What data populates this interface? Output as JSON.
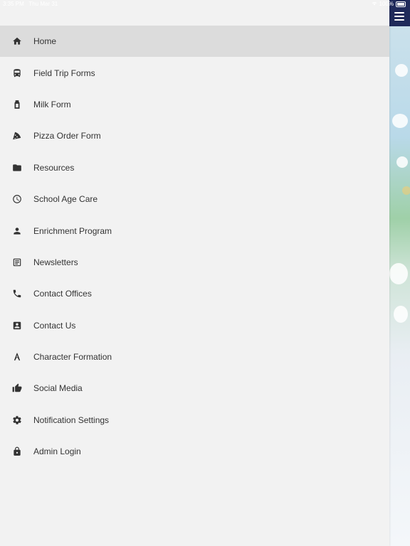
{
  "status_bar": {
    "time": "3:35 PM",
    "date": "Thu Mar 31",
    "battery": "100%"
  },
  "drawer": {
    "items": [
      {
        "label": "Home",
        "icon": "home-icon",
        "active": true
      },
      {
        "label": "Field Trip Forms",
        "icon": "bus-icon"
      },
      {
        "label": "Milk Form",
        "icon": "milk-carton-icon"
      },
      {
        "label": "Pizza Order Form",
        "icon": "pizza-icon"
      },
      {
        "label": "Resources",
        "icon": "folder-icon"
      },
      {
        "label": "School Age Care",
        "icon": "clock-icon"
      },
      {
        "label": "Enrichment Program",
        "icon": "person-icon"
      },
      {
        "label": "Newsletters",
        "icon": "document-icon"
      },
      {
        "label": "Contact Offices",
        "icon": "phone-icon"
      },
      {
        "label": "Contact Us",
        "icon": "contact-card-icon"
      },
      {
        "label": "Character Formation",
        "icon": "compass-icon"
      },
      {
        "label": "Social Media",
        "icon": "thumbs-up-icon"
      },
      {
        "label": "Notification Settings",
        "icon": "gear-icon"
      },
      {
        "label": "Admin Login",
        "icon": "lock-icon"
      }
    ]
  },
  "colors": {
    "drawer_bg": "#f2f2f2",
    "active_bg": "#dcdcdc",
    "app_bar": "#1f2a5a"
  }
}
